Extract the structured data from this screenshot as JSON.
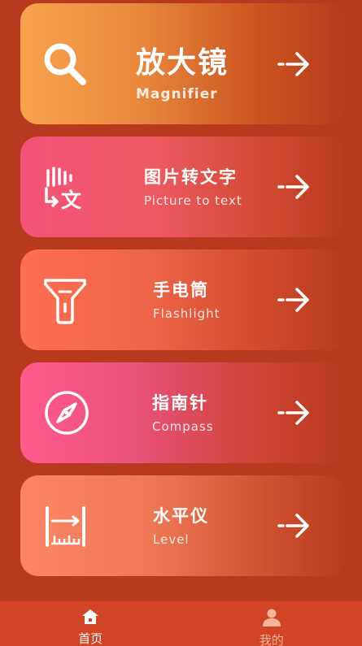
{
  "cards": [
    {
      "title": "放大镜",
      "subtitle": "Magnifier",
      "icon": "magnifier-icon"
    },
    {
      "title": "图片转文字",
      "subtitle": "Picture to text",
      "icon": "hand-text-icon"
    },
    {
      "title": "手电筒",
      "subtitle": "Flashlight",
      "icon": "flashlight-icon"
    },
    {
      "title": "指南针",
      "subtitle": "Compass",
      "icon": "compass-icon"
    },
    {
      "title": "水平仪",
      "subtitle": "Level",
      "icon": "level-ruler-icon"
    }
  ],
  "ocr_icon_glyph": "文",
  "tabbar": {
    "home_label": "首页",
    "mine_label": "我的"
  },
  "colors": {
    "background": "#B73A1E",
    "tabbar": "#D24426",
    "tab_inactive": "#F6B59A"
  }
}
